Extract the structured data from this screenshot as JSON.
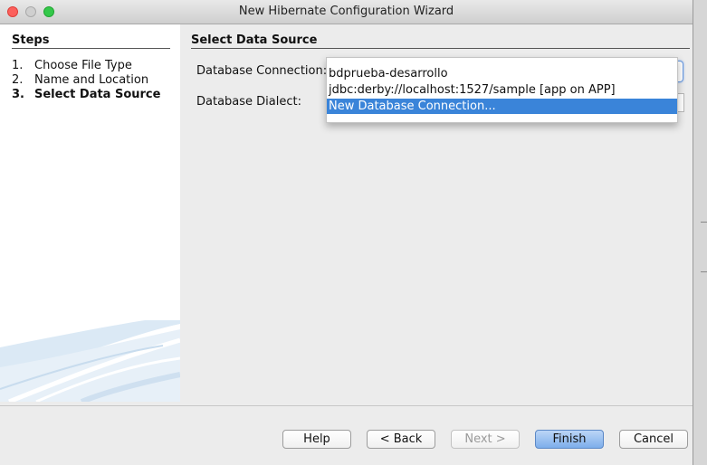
{
  "window": {
    "title": "New Hibernate Configuration Wizard"
  },
  "steps": {
    "title": "Steps",
    "items": [
      {
        "num": "1.",
        "label": "Choose File Type",
        "current": false
      },
      {
        "num": "2.",
        "label": "Name and Location",
        "current": false
      },
      {
        "num": "3.",
        "label": "Select Data Source",
        "current": true
      }
    ]
  },
  "content": {
    "section_title": "Select Data Source",
    "database_connection_label": "Database Connection:",
    "database_dialect_label": "Database Dialect:"
  },
  "dropdown": {
    "options": [
      "bdprueba-desarrollo",
      "jdbc:derby://localhost:1527/sample [app on APP]",
      "New Database Connection..."
    ],
    "highlighted": "New Database Connection..."
  },
  "buttons": {
    "help": "Help",
    "back": "< Back",
    "next": "Next >",
    "finish": "Finish",
    "cancel": "Cancel"
  },
  "colors": {
    "selection": "#3a84d9",
    "focus_ring": "#6a9be0",
    "default_button": "#7daeeb"
  }
}
